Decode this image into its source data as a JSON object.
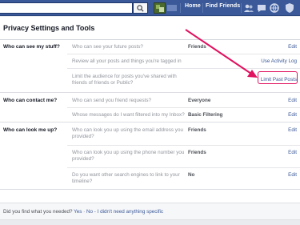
{
  "topbar": {
    "search_placeholder": "",
    "nav": [
      "Home",
      "Find Friends"
    ]
  },
  "page_title": "Privacy Settings and Tools",
  "sections": [
    {
      "label": "Who can see my stuff?",
      "rows": [
        {
          "question": "Who can see your future posts?",
          "value": "Friends",
          "action": "Edit"
        },
        {
          "question": "Review all your posts and things you're tagged in",
          "value": "",
          "action": "Use Activity Log"
        },
        {
          "question": "Limit the audience for posts you've shared with friends of friends or Public?",
          "value": "",
          "action": "Limit Past Posts"
        }
      ]
    },
    {
      "label": "Who can contact me?",
      "rows": [
        {
          "question": "Who can send you friend requests?",
          "value": "Everyone",
          "action": "Edit"
        },
        {
          "question": "Whose messages do I want filtered into my Inbox?",
          "value": "Basic Filtering",
          "action": "Edit"
        }
      ]
    },
    {
      "label": "Who can look me up?",
      "rows": [
        {
          "question": "Who can look you up using the email address you provided?",
          "value": "Friends",
          "action": "Edit"
        },
        {
          "question": "Who can look you up using the phone number you provided?",
          "value": "Friends",
          "action": "Edit"
        },
        {
          "question": "Do you want other search engines to link to your timeline?",
          "value": "No",
          "action": "Edit"
        }
      ]
    }
  ],
  "footer": {
    "question": "Did you find what you needed?",
    "yes": "Yes",
    "no": "No - I didn't need anything specific",
    "sep": " · "
  },
  "colors": {
    "brand": "#3b5998",
    "highlight": "#e0115f"
  }
}
